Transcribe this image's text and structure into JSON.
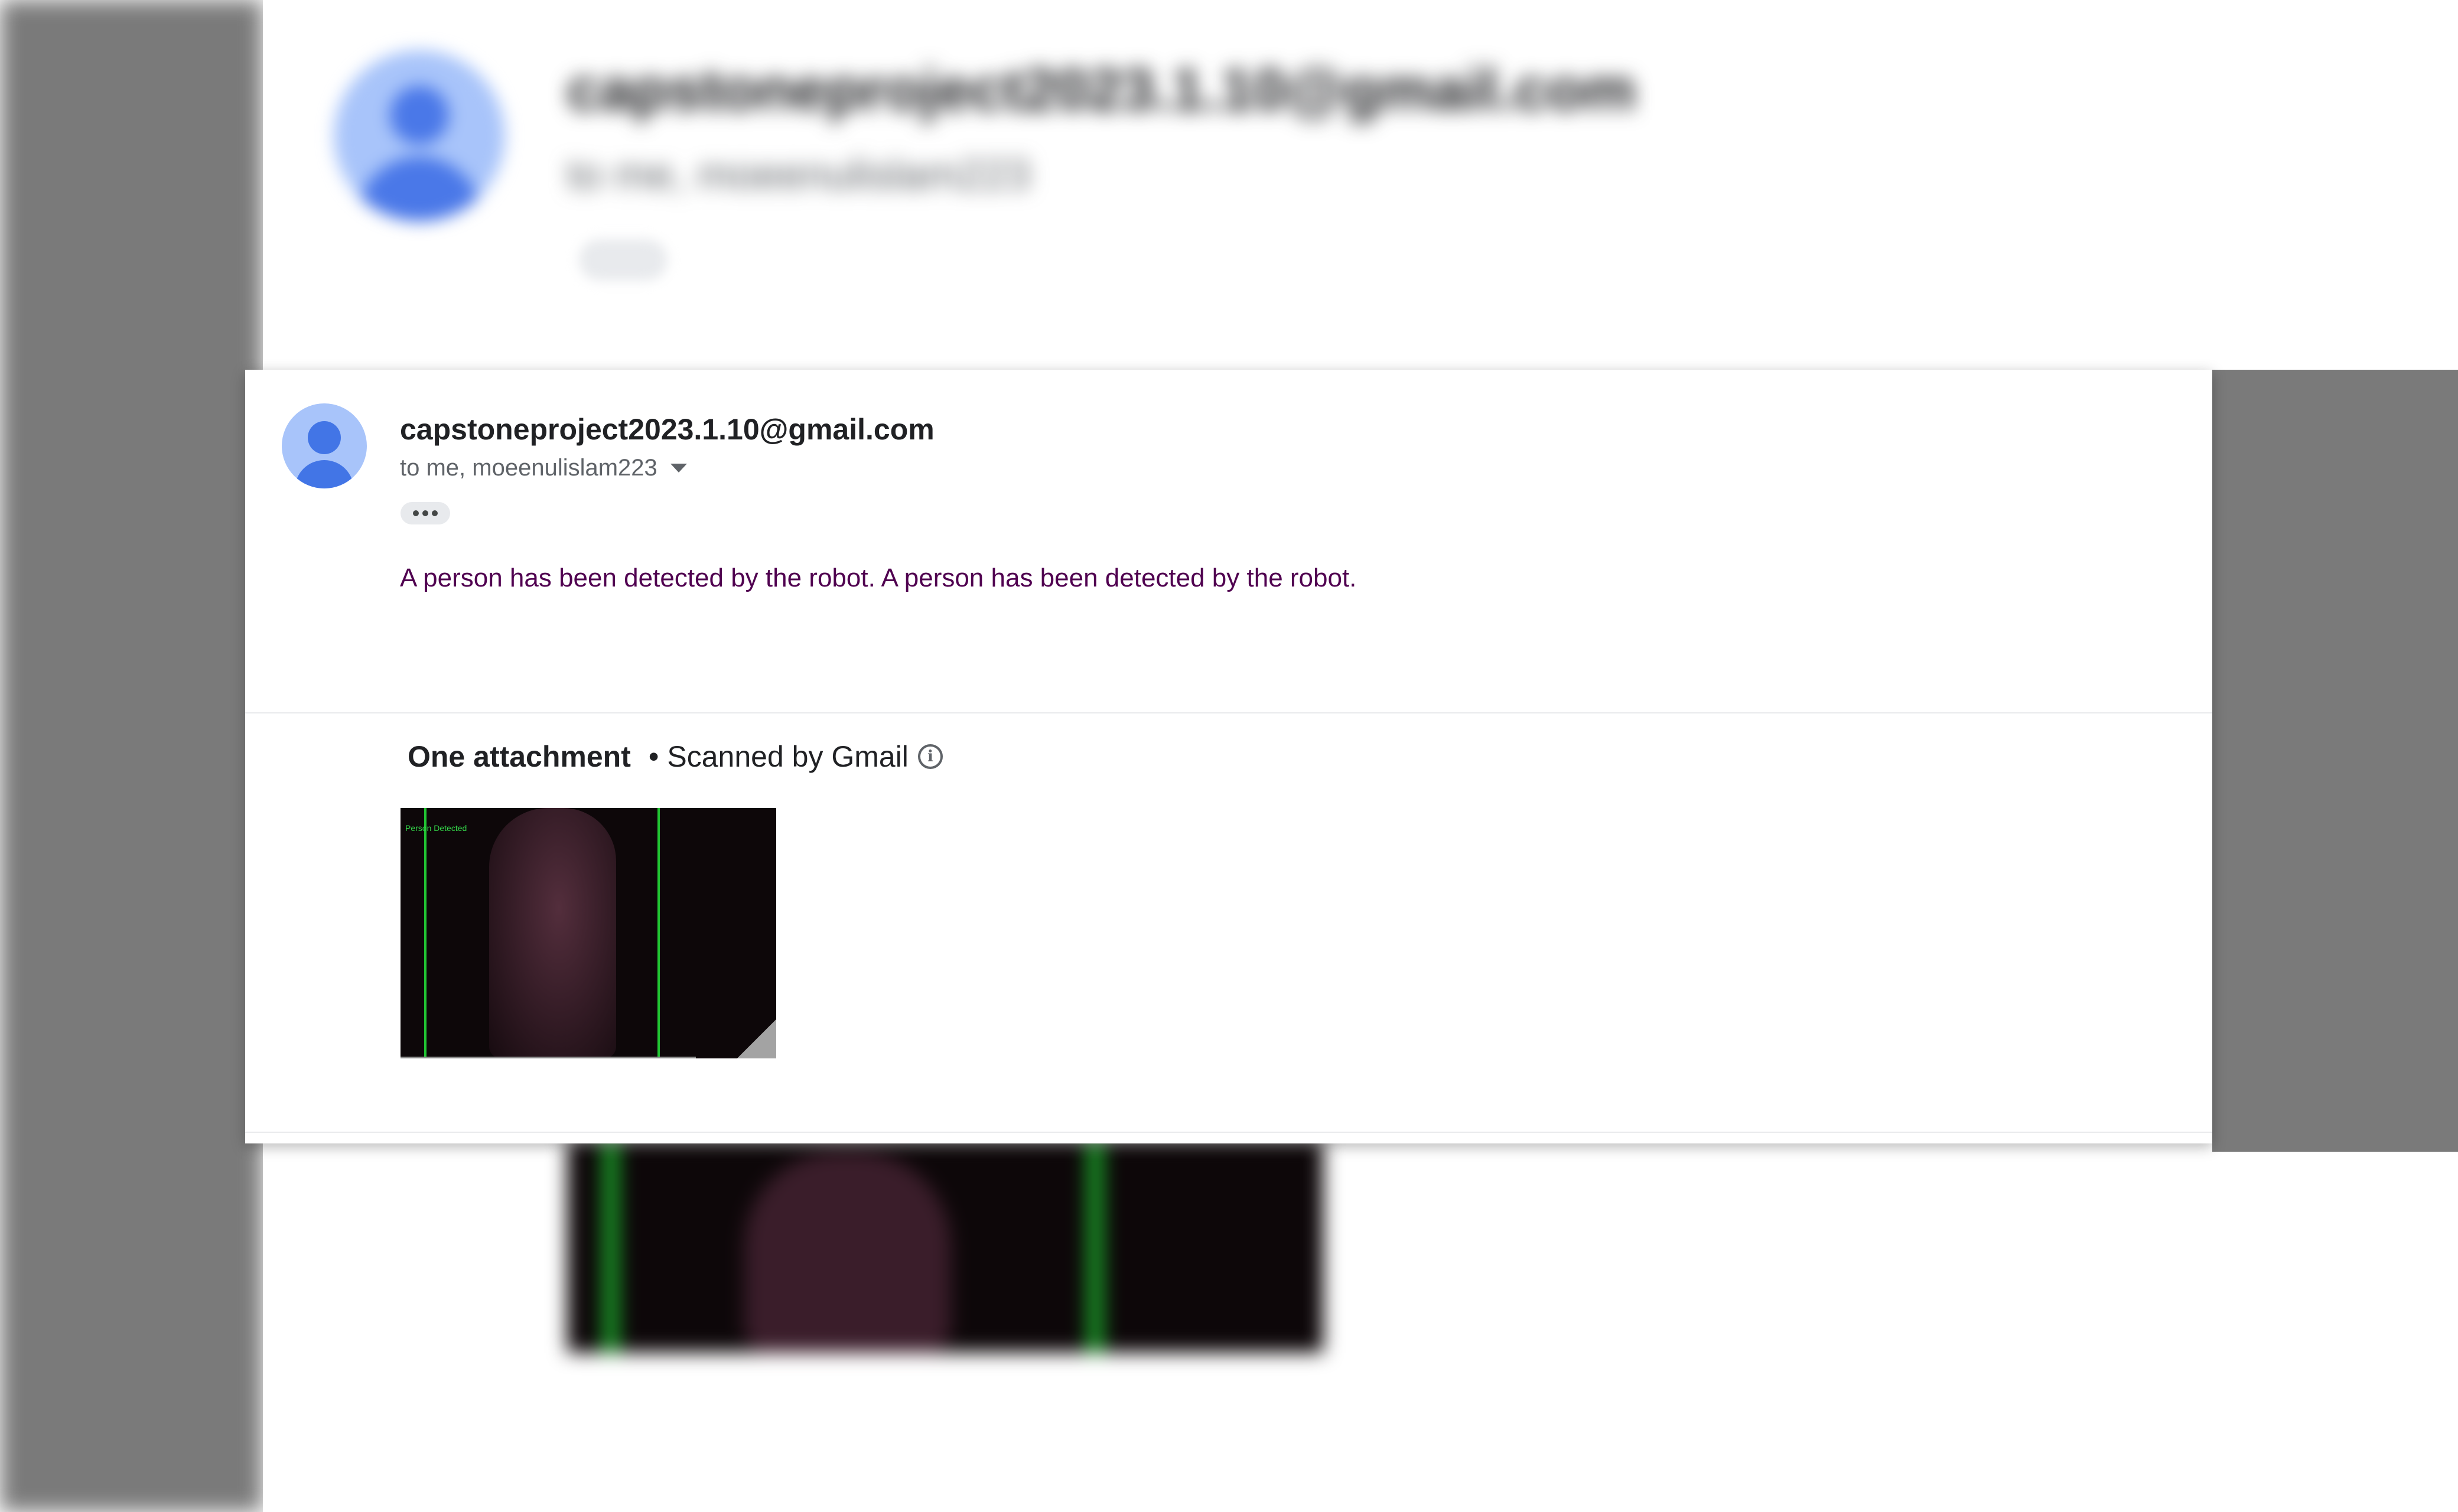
{
  "email": {
    "sender": "capstoneproject2023.1.10@gmail.com",
    "recipients": "to me, moeenulislam223",
    "body": "A person has been detected by the robot. A person has been detected by the robot."
  },
  "attachments": {
    "title": "One attachment",
    "separator": "•",
    "scanned_label": "Scanned by Gmail",
    "items": [
      {
        "image_caption": "Person Detected"
      }
    ]
  },
  "icons": {
    "avatar": "default-person-avatar",
    "recipients_toggle": "caret-down-icon",
    "more": "ellipsis-icon",
    "scan_info": "info-icon",
    "thumbnail_fold": "page-fold-icon"
  },
  "colors": {
    "body_text": "#500050",
    "avatar_bg": "#a8c4fa",
    "avatar_fg": "#4275e6",
    "detection_box": "#21c533"
  }
}
